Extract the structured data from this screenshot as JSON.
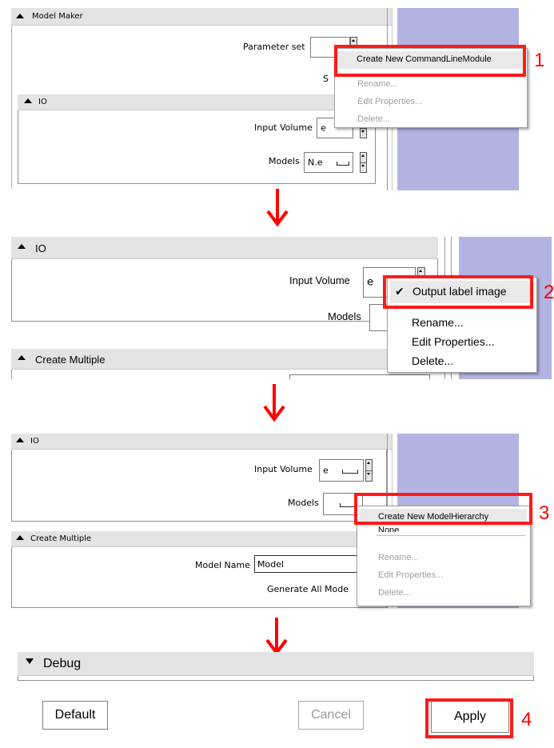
{
  "colors": {
    "highlight": "#ff1a1a",
    "step_number": "#ff0000",
    "arrow": "#ff0000",
    "side_panel": "#b3b3e3",
    "section_header": "#e3e3e3"
  },
  "step1": {
    "model_maker_header": "Model Maker",
    "parameter_set_label": "Parameter set",
    "io_header": "IO",
    "input_volume_label": "Input Volume",
    "input_volume_value": "e",
    "models_label": "Models",
    "models_value": "N.e",
    "partial_label": "S",
    "menu": {
      "create_new": "Create New CommandLineModule",
      "rename": "Rename...",
      "edit_properties": "Edit Properties...",
      "delete": "Delete..."
    },
    "step_number": "1"
  },
  "step2": {
    "io_header": "IO",
    "input_volume_label": "Input Volume",
    "input_volume_value": "e",
    "models_label": "Models",
    "create_multiple_header": "Create Multiple",
    "menu": {
      "checkmark": "✔",
      "output_label_image": "Output label image",
      "rename": "Rename...",
      "edit_properties": "Edit Properties...",
      "delete": "Delete..."
    },
    "step_number": "2"
  },
  "step3": {
    "io_header": "IO",
    "input_volume_label": "Input Volume",
    "input_volume_value": "e",
    "models_label": "Models",
    "create_multiple_header": "Create Multiple",
    "model_name_label": "Model Name",
    "model_name_value": "Model",
    "generate_all_label": "Generate All Mode",
    "menu": {
      "create_new": "Create New ModelHierarchy",
      "none": "None",
      "rename": "Rename...",
      "edit_properties": "Edit Properties...",
      "delete": "Delete..."
    },
    "step_number": "3"
  },
  "step4": {
    "debug_header": "Debug",
    "default_button": "Default",
    "cancel_button": "Cancel",
    "apply_button": "Apply",
    "step_number": "4"
  }
}
